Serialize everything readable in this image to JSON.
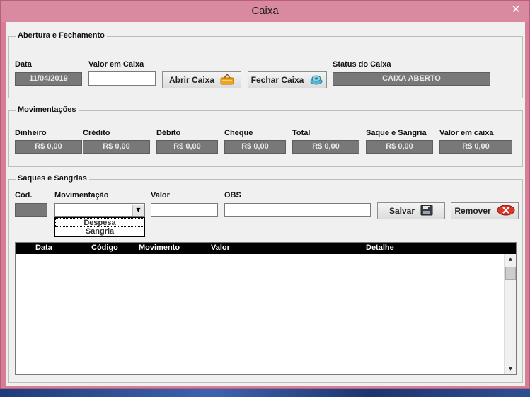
{
  "window": {
    "title": "Caixa",
    "close_glyph": "✕"
  },
  "abertura": {
    "legend": "Abertura e Fechamento",
    "data_label": "Data",
    "data_value": "11/04/2019",
    "valor_label": "Valor em Caixa",
    "valor_value": "",
    "abrir_label": "Abrir Caixa",
    "fechar_label": "Fechar Caixa",
    "status_label": "Status do Caixa",
    "status_value": "CAIXA ABERTO"
  },
  "movimentacoes": {
    "legend": "Movimentações",
    "fields": [
      {
        "label": "Dinheiro",
        "value": "R$ 0,00"
      },
      {
        "label": "Crédito",
        "value": "R$ 0,00"
      },
      {
        "label": "Débito",
        "value": "R$ 0,00"
      },
      {
        "label": "Cheque",
        "value": "R$ 0,00"
      },
      {
        "label": "Total",
        "value": "R$ 0,00"
      },
      {
        "label": "Saque e Sangria",
        "value": "R$ 0,00"
      },
      {
        "label": "Valor em caixa",
        "value": "R$ 0,00"
      }
    ]
  },
  "saques": {
    "legend": "Saques e Sangrias",
    "cod_label": "Cód.",
    "mov_label": "Movimentação",
    "valor_label": "Valor",
    "obs_label": "OBS",
    "mov_options": [
      "Despesa",
      "Sangria"
    ],
    "salvar_label": "Salvar",
    "remover_label": "Remover"
  },
  "grid": {
    "columns": [
      "Data",
      "Código",
      "Movimento",
      "Valor",
      "Detalhe"
    ]
  },
  "icons": {
    "abrir": "basket-icon",
    "fechar": "coins-icon",
    "salvar": "floppy-disk-icon",
    "remover": "remove-icon"
  }
}
